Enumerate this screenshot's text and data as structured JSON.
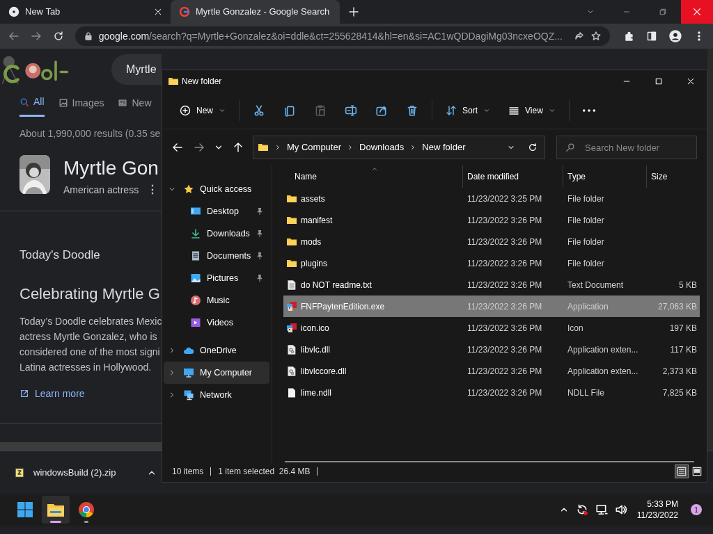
{
  "browser": {
    "tabs": [
      {
        "title": "New Tab",
        "kind": "newtab",
        "selected": false
      },
      {
        "title": "Myrtle Gonzalez - Google Search",
        "kind": "google",
        "selected": true
      }
    ],
    "url": {
      "host": "google.com",
      "path": "/search?q=Myrtle+Gonzalez&oi=ddle&ct=255628414&hl=en&si=AC1wQDDagiMg03ncxeOQZ..."
    },
    "page": {
      "search_value": "Myrtle",
      "result_tabs": [
        {
          "label": "All",
          "kind": "search",
          "selected": true
        },
        {
          "label": "Images",
          "kind": "images",
          "selected": false
        },
        {
          "label": "New",
          "kind": "news",
          "selected": false
        }
      ],
      "result_stats": "About 1,990,000 results (0.35 se",
      "entity": {
        "title": "Myrtle Gon",
        "subtitle": "American actress",
        "menu": "⋮"
      },
      "doodle": {
        "heading": "Today's Doodle",
        "title": "Celebrating Myrtle G",
        "lines": [
          "Today’s Doodle celebrates Mexic",
          "actress Myrtle Gonzalez, who is",
          "considered one of the most signi",
          "Latina actresses in Hollywood."
        ],
        "link": "Learn more"
      }
    },
    "downloads": [
      {
        "name": "windowsBuild (2).zip"
      }
    ]
  },
  "explorer": {
    "title": "New folder",
    "toolbar": [
      {
        "kind": "new",
        "label": "New",
        "disabled": false
      },
      {
        "kind": "cut",
        "disabled": false
      },
      {
        "kind": "copy",
        "disabled": false
      },
      {
        "kind": "paste",
        "disabled": true
      },
      {
        "kind": "rename",
        "disabled": false
      },
      {
        "kind": "share",
        "disabled": false
      },
      {
        "kind": "delete",
        "disabled": false
      },
      {
        "kind": "sort",
        "label": "Sort",
        "disabled": false
      },
      {
        "kind": "view",
        "label": "View",
        "disabled": false
      },
      {
        "kind": "more",
        "disabled": false
      }
    ],
    "breadcrumb": [
      "My Computer",
      "Downloads",
      "New folder"
    ],
    "search_placeholder": "Search New folder",
    "nav": [
      {
        "label": "Quick access",
        "kind": "star",
        "expanded": true,
        "selected": false,
        "children": [
          {
            "label": "Desktop",
            "kind": "desktop",
            "pinned": true,
            "selected": false
          },
          {
            "label": "Downloads",
            "kind": "download",
            "pinned": true,
            "selected": false
          },
          {
            "label": "Documents",
            "kind": "documents",
            "pinned": true,
            "selected": false
          },
          {
            "label": "Pictures",
            "kind": "pictures",
            "pinned": true,
            "selected": false
          },
          {
            "label": "Music",
            "kind": "music",
            "pinned": false,
            "selected": false
          },
          {
            "label": "Videos",
            "kind": "videos",
            "pinned": false,
            "selected": false
          }
        ]
      },
      {
        "label": "OneDrive",
        "kind": "cloud",
        "expanded": false,
        "selected": false
      },
      {
        "label": "My Computer",
        "kind": "computer",
        "expanded": false,
        "selected": true
      },
      {
        "label": "Network",
        "kind": "network",
        "expanded": false,
        "selected": false
      }
    ],
    "columns": [
      "Name",
      "Date modified",
      "Type",
      "Size"
    ],
    "files": [
      {
        "name": "assets",
        "kind": "folder",
        "date": "11/23/2022 3:25 PM",
        "type": "File folder",
        "selected": false
      },
      {
        "name": "manifest",
        "kind": "folder",
        "date": "11/23/2022 3:26 PM",
        "type": "File folder",
        "selected": false
      },
      {
        "name": "mods",
        "kind": "folder",
        "date": "11/23/2022 3:26 PM",
        "type": "File folder",
        "selected": false
      },
      {
        "name": "plugins",
        "kind": "folder",
        "date": "11/23/2022 3:26 PM",
        "type": "File folder",
        "selected": false
      },
      {
        "name": "do NOT readme.txt",
        "kind": "text",
        "date": "11/23/2022 3:26 PM",
        "type": "Text Document",
        "size": "5 KB",
        "selected": false
      },
      {
        "name": "FNFPaytenEdition.exe",
        "kind": "app",
        "date": "11/23/2022 3:26 PM",
        "type": "Application",
        "size": "27,063 KB",
        "selected": true
      },
      {
        "name": "icon.ico",
        "kind": "app",
        "date": "11/23/2022 3:26 PM",
        "type": "Icon",
        "size": "197 KB",
        "selected": false
      },
      {
        "name": "libvlc.dll",
        "kind": "dll",
        "date": "11/23/2022 3:26 PM",
        "type": "Application exten...",
        "size": "117 KB",
        "selected": false
      },
      {
        "name": "libvlccore.dll",
        "kind": "dll",
        "date": "11/23/2022 3:26 PM",
        "type": "Application exten...",
        "size": "2,373 KB",
        "selected": false
      },
      {
        "name": "lime.ndll",
        "kind": "file",
        "date": "11/23/2022 3:26 PM",
        "type": "NDLL File",
        "size": "7,825 KB",
        "selected": false
      }
    ],
    "status": {
      "count": "10 items",
      "selection": "1 item selected  26.4 MB"
    },
    "view_modes": [
      {
        "kind": "details",
        "selected": true
      },
      {
        "kind": "tiles",
        "selected": false
      }
    ]
  },
  "taskbar": {
    "apps": [
      {
        "kind": "start",
        "active": false,
        "running": false
      },
      {
        "kind": "explorer",
        "active": true,
        "running": true
      },
      {
        "kind": "chrome",
        "active": false,
        "running": true
      }
    ],
    "time": "5:33 PM",
    "date": "11/23/2022",
    "notifications": "1"
  }
}
